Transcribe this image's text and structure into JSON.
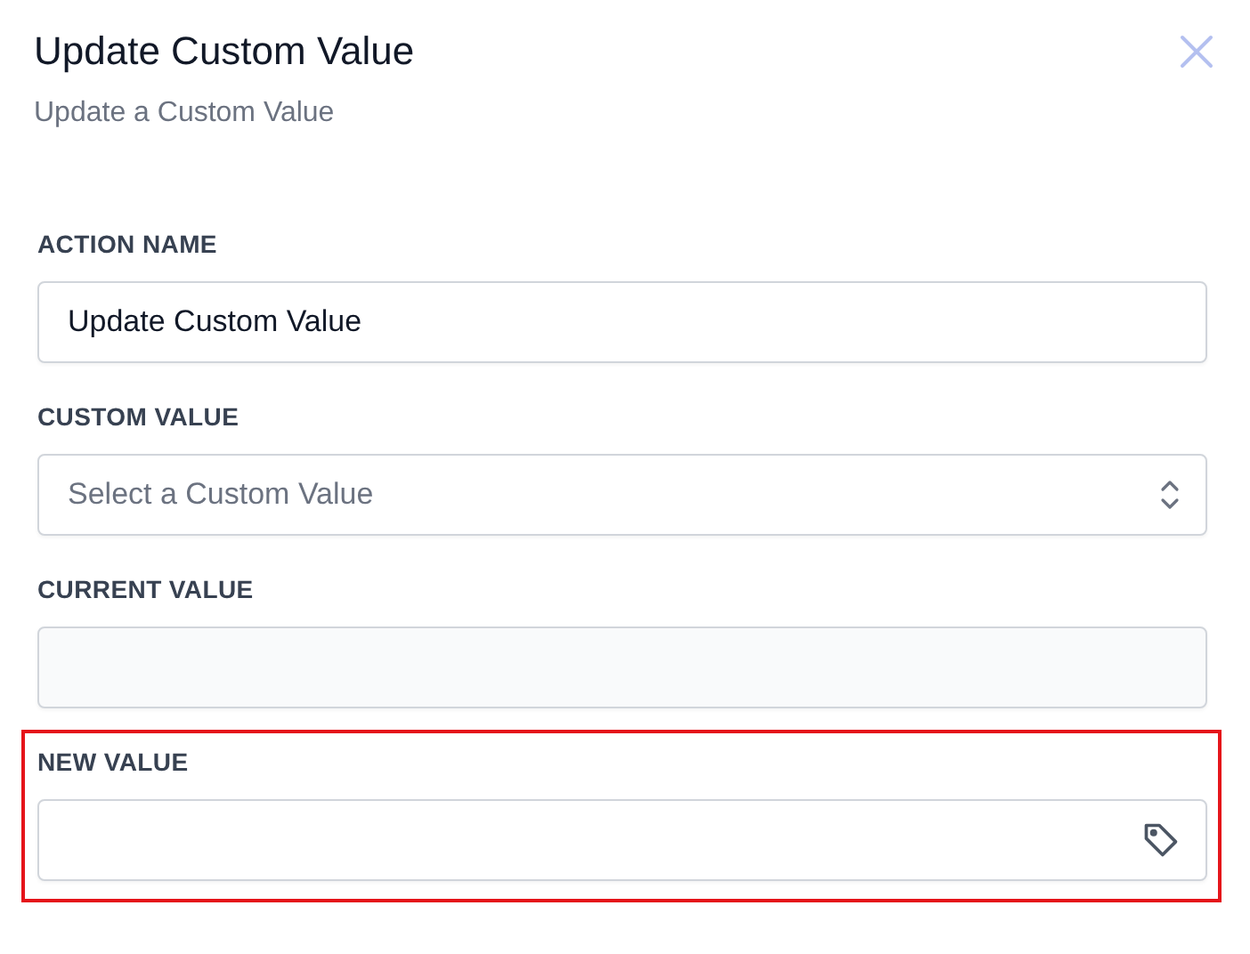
{
  "dialog": {
    "title": "Update Custom Value",
    "subtitle": "Update a Custom Value"
  },
  "fields": [
    {
      "kind": "text",
      "label": "ACTION NAME",
      "value": "Update Custom Value",
      "highlighted": false
    },
    {
      "kind": "select",
      "label": "CUSTOM VALUE",
      "placeholder": "Select a Custom Value",
      "highlighted": false
    },
    {
      "kind": "readonly",
      "label": "CURRENT VALUE",
      "highlighted": false
    },
    {
      "kind": "tag",
      "label": "NEW VALUE",
      "highlighted": true
    }
  ]
}
